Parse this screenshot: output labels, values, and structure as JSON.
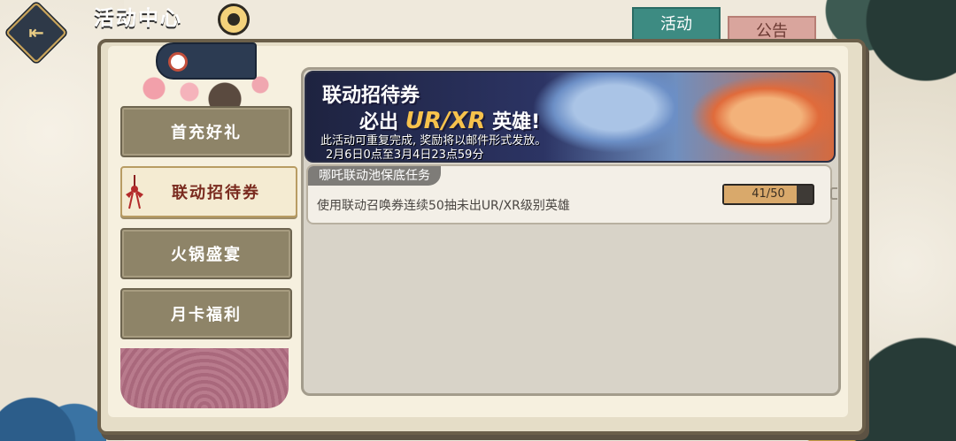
{
  "header": {
    "title": "活动中心",
    "back_icon_glyph": "⇤"
  },
  "tabs": [
    {
      "label": "活动",
      "active": true,
      "color": "#3d8b82"
    },
    {
      "label": "公告",
      "active": false,
      "color": "#d9a59d"
    }
  ],
  "sidebar": {
    "items": [
      {
        "label": "首充好礼",
        "active": false
      },
      {
        "label": "联动招待券",
        "active": true
      },
      {
        "label": "火锅盛宴",
        "active": false
      },
      {
        "label": "月卡福利",
        "active": false
      }
    ]
  },
  "banner": {
    "title_line1": "联动招待券",
    "title_line2_prefix": "必出",
    "title_line2_highlight": "UR/XR",
    "title_line2_suffix": "英雄!",
    "description": "此活动可重复完成, 奖励将以邮件形式发放。",
    "time": "2月6日0点至3月4日23点59分"
  },
  "task": {
    "header": "哪吒联动池保底任务",
    "description": "使用联动召唤券连续50抽未出UR/XR级别英雄",
    "progress_text": "41/50",
    "progress_value": 0.82
  },
  "colors": {
    "accent_teal": "#3d8b82",
    "accent_pink": "#d9a59d",
    "progress_fill": "#d9a96b"
  }
}
